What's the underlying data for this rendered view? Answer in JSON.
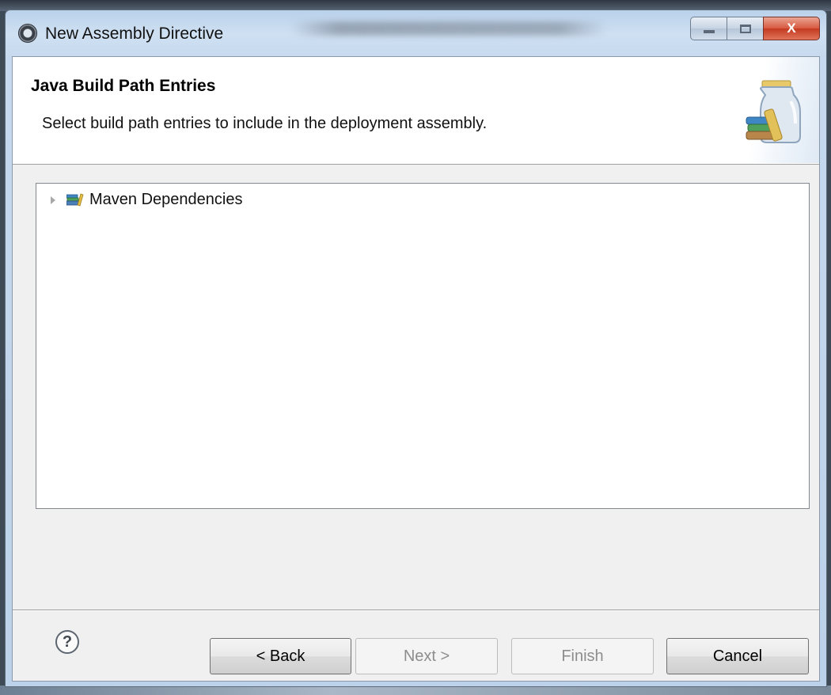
{
  "window": {
    "title": "New Assembly Directive",
    "caption_buttons": {
      "minimize_icon": "minimize-icon",
      "maximize_icon": "maximize-icon",
      "close_label": "X"
    }
  },
  "header": {
    "title": "Java Build Path Entries",
    "description": "Select build path entries to include in the deployment assembly.",
    "banner_icon": "library-jar-icon"
  },
  "tree": {
    "items": [
      {
        "label": "Maven Dependencies",
        "icon": "library-icon",
        "expanded": false
      }
    ]
  },
  "footer": {
    "help_label": "?",
    "back_label": "< Back",
    "next_label": "Next >",
    "finish_label": "Finish",
    "cancel_label": "Cancel"
  },
  "colors": {
    "title_bar": "#c6d9ee",
    "close_button": "#c33a20",
    "dialog_background": "#f0f0f0"
  }
}
